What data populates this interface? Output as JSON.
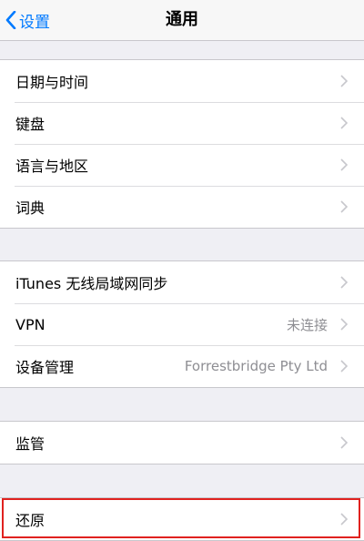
{
  "navbar": {
    "back_label": "设置",
    "title": "通用"
  },
  "group1": [
    {
      "label": "日期与时间"
    },
    {
      "label": "键盘"
    },
    {
      "label": "语言与地区"
    },
    {
      "label": "词典"
    }
  ],
  "group2": [
    {
      "label": "iTunes 无线局域网同步"
    },
    {
      "label": "VPN",
      "value": "未连接"
    },
    {
      "label": "设备管理",
      "value": "Forrestbridge Pty Ltd"
    }
  ],
  "group3": [
    {
      "label": "监管"
    }
  ],
  "group4": [
    {
      "label": "还原"
    }
  ],
  "colors": {
    "accent": "#007aff",
    "background": "#efeff4",
    "highlight": "#e0221f"
  }
}
